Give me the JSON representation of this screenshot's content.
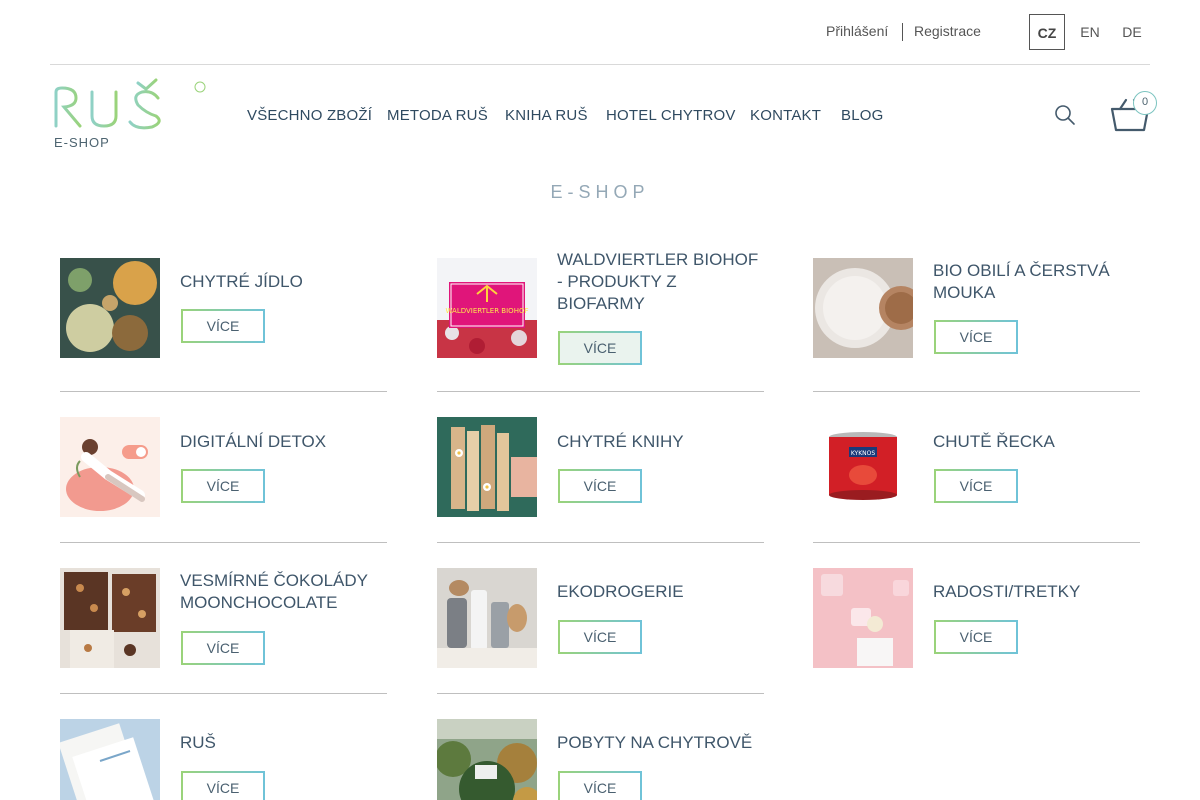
{
  "auth": {
    "login": "Přihlášení",
    "register": "Registrace"
  },
  "languages": [
    "CZ",
    "EN",
    "DE"
  ],
  "logo": {
    "brand": "RUŠ",
    "sub": "E-SHOP"
  },
  "nav": [
    "VŠECHNO ZBOŽÍ",
    "METODA RUŠ",
    "KNIHA RUŠ",
    "HOTEL CHYTROV",
    "KONTAKT",
    "BLOG"
  ],
  "cart": {
    "count": "0"
  },
  "page_title": "E-SHOP",
  "more_label": "VÍCE",
  "categories": [
    {
      "title": "CHYTRÉ JÍDLO"
    },
    {
      "title": "WALDVIERTLER BIOHOF - PRODUKTY Z BIOFARMY",
      "image_text": "WALDVIERTLER BIOHOF"
    },
    {
      "title": "BIO OBILÍ A ČERSTVÁ MOUKA"
    },
    {
      "title": "DIGITÁLNÍ DETOX"
    },
    {
      "title": "CHYTRÉ KNIHY"
    },
    {
      "title": "CHUTĚ ŘECKA",
      "image_text": "KYKNOS"
    },
    {
      "title": "VESMÍRNÉ ČOKOLÁDY MOONCHOCOLATE"
    },
    {
      "title": "EKODROGERIE"
    },
    {
      "title": "RADOSTI/TRETKY"
    },
    {
      "title": "RUŠ"
    },
    {
      "title": "POBYTY NA CHYTROVĚ"
    }
  ],
  "colors": {
    "accent_green": "#9ad37a",
    "accent_teal": "#6fc3d8",
    "text": "#3f566a"
  }
}
